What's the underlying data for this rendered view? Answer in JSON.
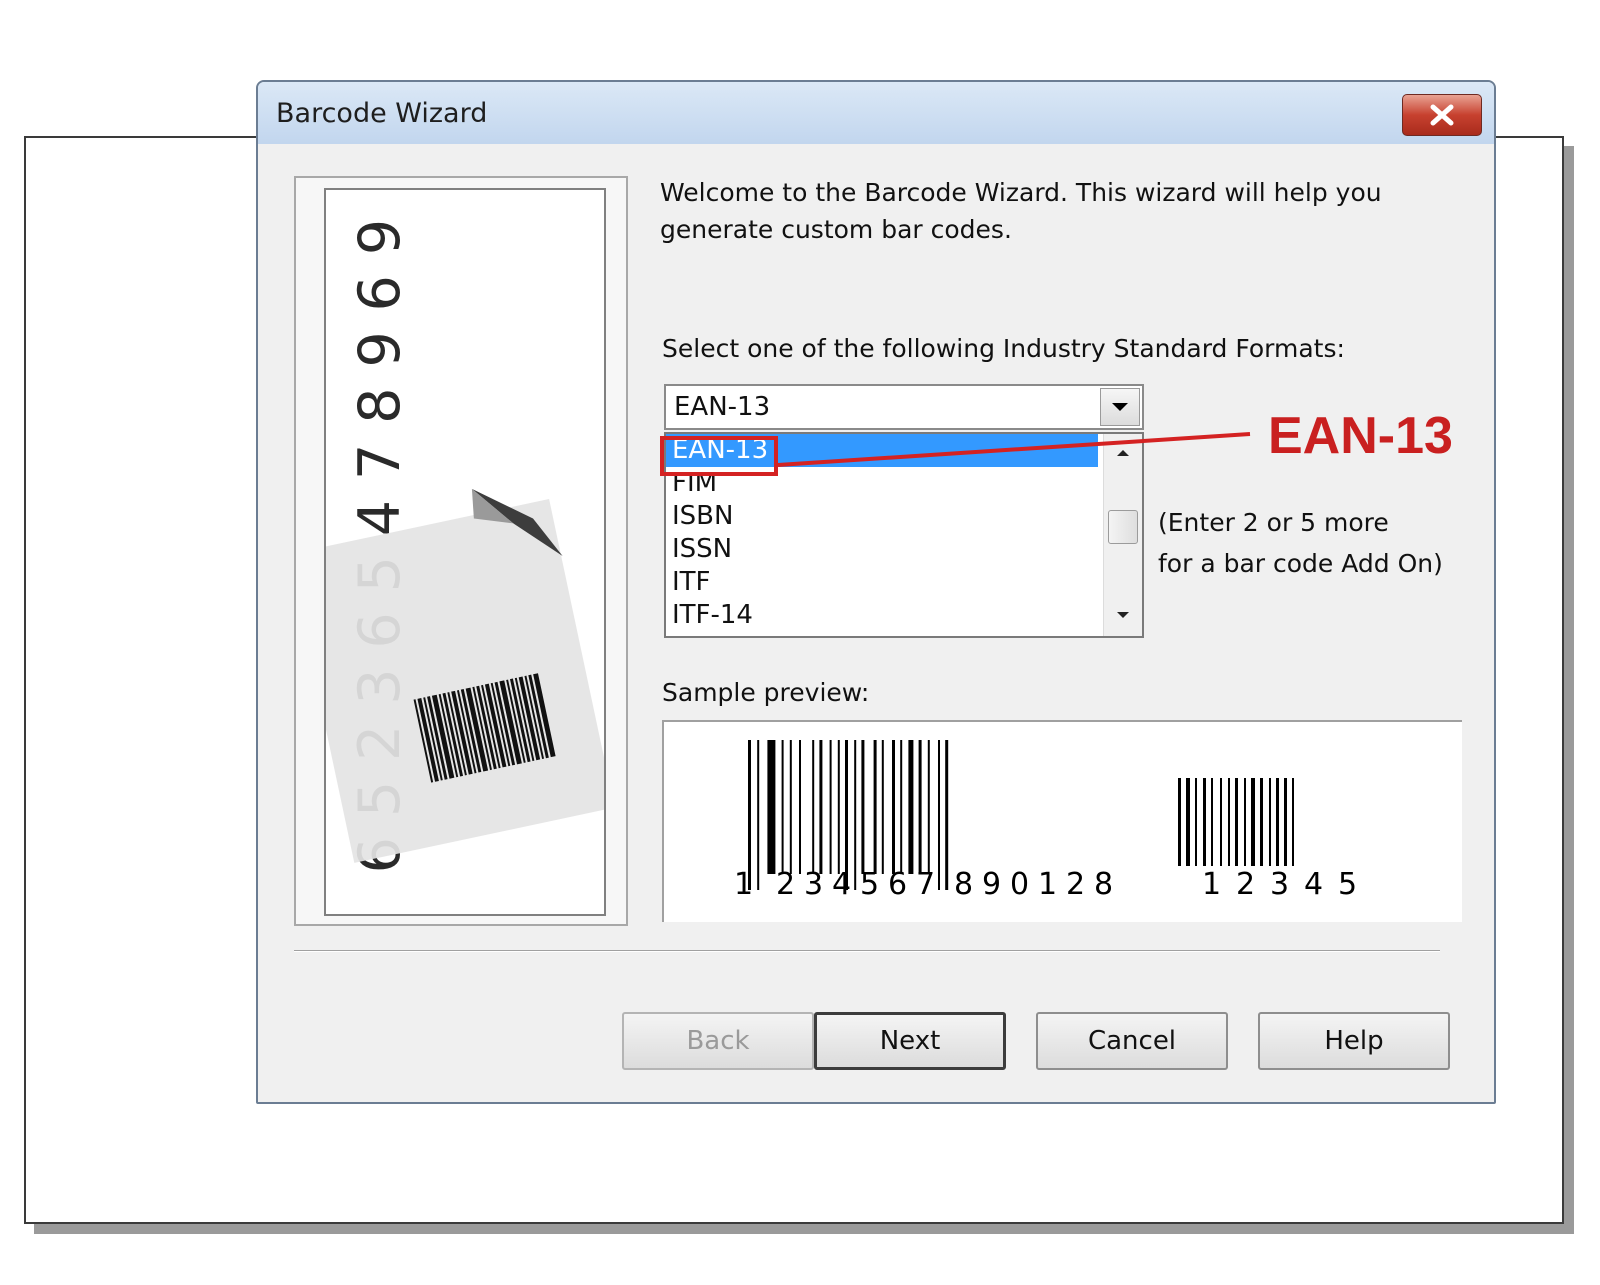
{
  "window": {
    "title": "Barcode Wizard",
    "close_icon": "close-icon"
  },
  "welcome": {
    "line1": "Welcome to the Barcode Wizard.  This wizard will help you",
    "line2": "generate custom bar codes."
  },
  "format": {
    "label": "Select one of the following Industry Standard Formats:",
    "selected_value": "EAN-13",
    "options": [
      "EAN-13",
      "FIM",
      "ISBN",
      "ISSN",
      "ITF",
      "ITF-14"
    ],
    "highlighted_index": 0
  },
  "addon_hint": {
    "line1": "(Enter 2 or 5 more",
    "line2": "for a bar code Add On)"
  },
  "preview": {
    "label": "Sample preview:",
    "main_digits": [
      "1",
      "2",
      "3",
      "4",
      "5",
      "6",
      "7",
      "8",
      "9",
      "0",
      "1",
      "2",
      "8"
    ],
    "addon_digits": [
      "1",
      "2",
      "3",
      "4",
      "5"
    ]
  },
  "art": {
    "digits": [
      "6",
      "5",
      "2",
      "3",
      "6",
      "5",
      "4",
      "7",
      "8",
      "9",
      "6",
      "9"
    ]
  },
  "buttons": {
    "back": "Back",
    "next": "Next",
    "cancel": "Cancel",
    "help": "Help"
  },
  "annotation": {
    "label": "EAN-13",
    "color": "#c92020"
  },
  "colors": {
    "selection": "#3399ff",
    "close_button": "#c7412f"
  }
}
